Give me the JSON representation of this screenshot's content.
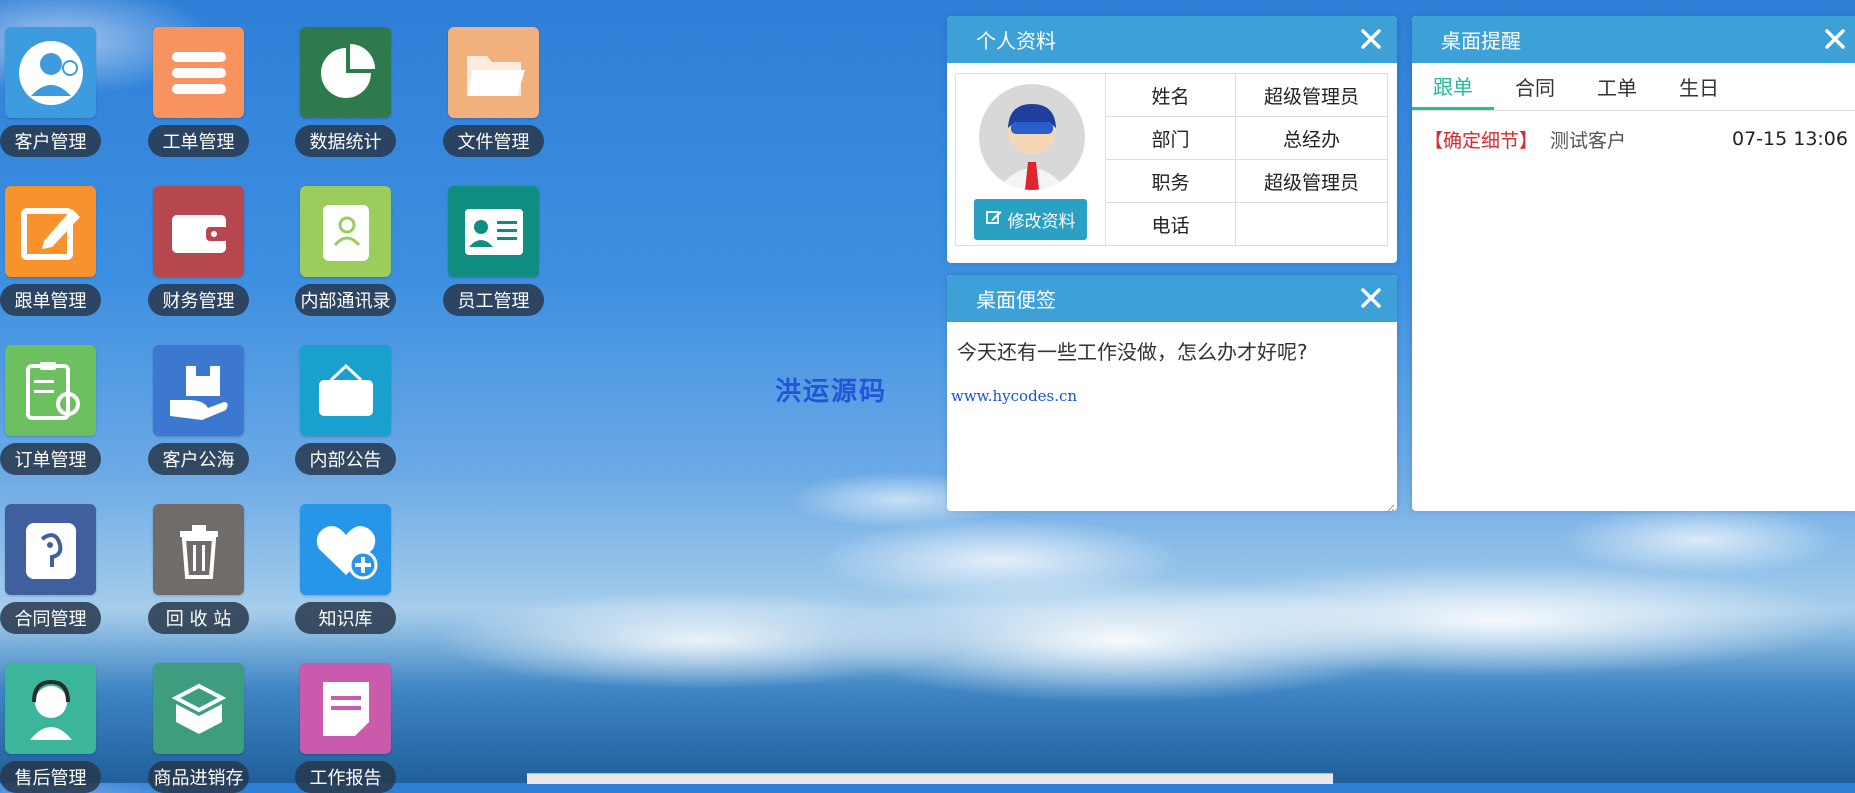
{
  "desktop": {
    "apps": [
      {
        "label": "客户管理",
        "icon": "customer-icon",
        "color": "#3d9be0"
      },
      {
        "label": "工单管理",
        "icon": "list-icon",
        "color": "#f8935f"
      },
      {
        "label": "数据统计",
        "icon": "pie-chart-icon",
        "color": "#2f7a4c"
      },
      {
        "label": "文件管理",
        "icon": "folder-icon",
        "color": "#f1b07e"
      },
      {
        "label": "跟单管理",
        "icon": "edit-icon",
        "color": "#f8922c"
      },
      {
        "label": "财务管理",
        "icon": "wallet-icon",
        "color": "#b6474f"
      },
      {
        "label": "内部通讯录",
        "icon": "contacts-icon",
        "color": "#9ccc5b"
      },
      {
        "label": "员工管理",
        "icon": "id-card-icon",
        "color": "#0f8d80"
      },
      {
        "label": "订单管理",
        "icon": "clipboard-gear-icon",
        "color": "#6cc05f"
      },
      {
        "label": "客户公海",
        "icon": "hand-box-icon",
        "color": "#3d78d0"
      },
      {
        "label": "内部公告",
        "icon": "notice-board-icon",
        "color": "#19a0cf"
      },
      {
        "label": "合同管理",
        "icon": "contract-icon",
        "color": "#3f5f9f"
      },
      {
        "label": "回 收 站",
        "icon": "trash-icon",
        "color": "#6f6c6a"
      },
      {
        "label": "知识库",
        "icon": "heart-plus-icon",
        "color": "#2795e8"
      },
      {
        "label": "售后管理",
        "icon": "support-agent-icon",
        "color": "#3bb69b"
      },
      {
        "label": "商品进销存",
        "icon": "box-icon",
        "color": "#3e9d7f"
      },
      {
        "label": "工作报告",
        "icon": "report-icon",
        "color": "#c95aac"
      }
    ],
    "watermark": "洪运源码"
  },
  "profile_panel": {
    "title": "个人资料",
    "edit_button": "修改资料",
    "rows": [
      {
        "key": "姓名",
        "value": "超级管理员"
      },
      {
        "key": "部门",
        "value": "总经办"
      },
      {
        "key": "职务",
        "value": "超级管理员"
      },
      {
        "key": "电话",
        "value": ""
      }
    ]
  },
  "note_panel": {
    "title": "桌面便签",
    "text": "今天还有一些工作没做，怎么办才好呢?",
    "link": "www.hycodes.cn"
  },
  "reminder_panel": {
    "title": "桌面提醒",
    "tabs": [
      "跟单",
      "合同",
      "工单",
      "生日"
    ],
    "active_tab": 0,
    "items": [
      {
        "tag": "【确定细节】",
        "customer": "测试客户",
        "time": "07-15 13:06"
      }
    ]
  },
  "colors": {
    "panel_header": "#3da0d6",
    "tab_active": "#26b99a",
    "tag_red": "#d9282e",
    "edit_button": "#2aa0c2"
  }
}
